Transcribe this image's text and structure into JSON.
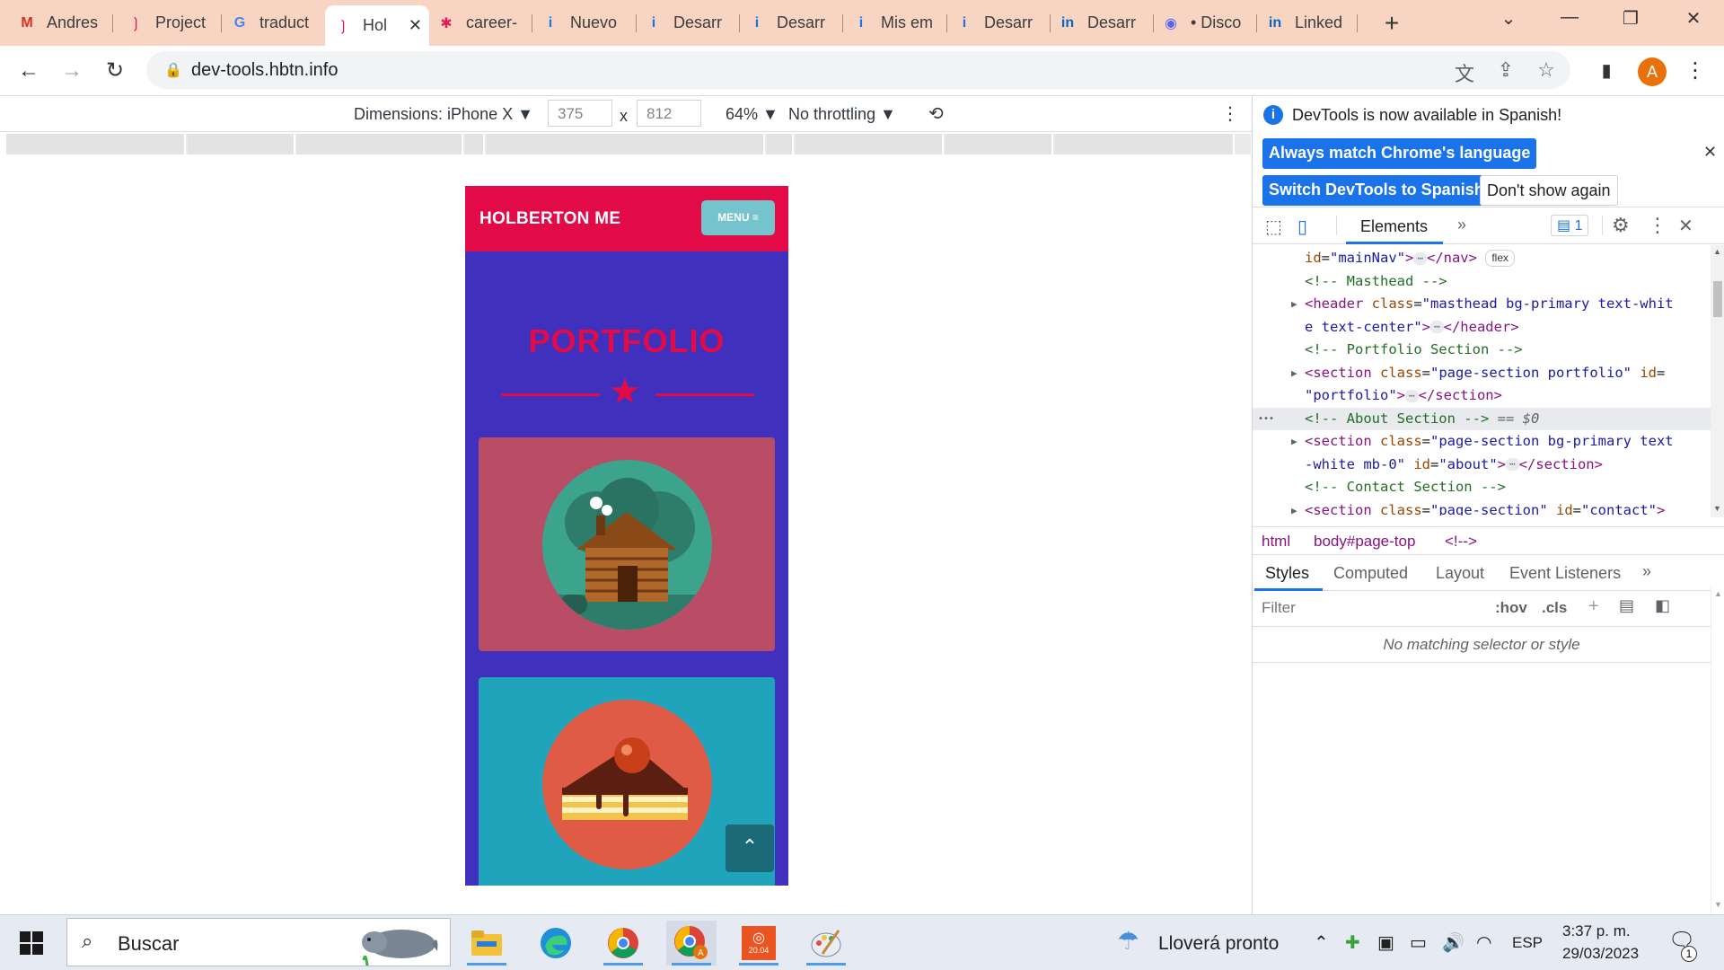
{
  "browser": {
    "tabs": [
      {
        "label": "Andres",
        "icon": "gmail-icon"
      },
      {
        "label": "Project",
        "icon": "holberton-icon"
      },
      {
        "label": "traduct",
        "icon": "google-icon"
      },
      {
        "label": "Hol",
        "icon": "holberton-icon",
        "active": true
      },
      {
        "label": "career-",
        "icon": "slack-icon"
      },
      {
        "label": "Nuevo",
        "icon": "info-icon"
      },
      {
        "label": "Desarr",
        "icon": "info-icon"
      },
      {
        "label": "Desarr",
        "icon": "info-icon"
      },
      {
        "label": "Mis em",
        "icon": "info-icon"
      },
      {
        "label": "Desarr",
        "icon": "info-icon"
      },
      {
        "label": "Desarr",
        "icon": "linkedin-icon"
      },
      {
        "label": "• Disco",
        "icon": "discord-icon"
      },
      {
        "label": "Linked",
        "icon": "linkedin-icon"
      }
    ],
    "url": "dev-tools.hbtn.info",
    "profile_initial": "A"
  },
  "device_toolbar": {
    "dimensions_label": "Dimensions: iPhone X ▼",
    "width": "375",
    "times": "x",
    "height": "812",
    "zoom": "64% ▼",
    "throttle": "No throttling ▼"
  },
  "page": {
    "brand": "HOLBERTON ME",
    "menu_label": "MENU ≡",
    "section_title": "PORTFOLIO",
    "colors": {
      "nav": "#e20a47",
      "bg": "#3f31bd",
      "card1": "#ba4d66",
      "card2": "#20a4bb"
    }
  },
  "devtools": {
    "info_text": "DevTools is now available in Spanish!",
    "btn_match": "Always match Chrome's language",
    "btn_switch": "Switch DevTools to Spanish",
    "btn_dont_show": "Don't show again",
    "panel_tab": "Elements",
    "issues_count": "1",
    "dom_lines": [
      {
        "parts": [
          [
            "an",
            "id"
          ],
          [
            "pl",
            "="
          ],
          [
            "av",
            "\"mainNav\""
          ],
          [
            "tg",
            ">"
          ]
        ],
        "ell": true,
        "after": [
          [
            "tg",
            "</nav>"
          ]
        ],
        "badge": "flex"
      },
      {
        "parts": [
          [
            "cm",
            "<!-- Masthead -->"
          ]
        ]
      },
      {
        "tri": true,
        "parts": [
          [
            "tg",
            "<header "
          ],
          [
            "an",
            "class"
          ],
          [
            "pl",
            "="
          ],
          [
            "av",
            "\"masthead bg-primary text-whit"
          ]
        ]
      },
      {
        "parts": [
          [
            "av",
            "e text-center\""
          ],
          [
            "tg",
            ">"
          ]
        ],
        "ell": true,
        "after": [
          [
            "tg",
            "</header>"
          ]
        ]
      },
      {
        "parts": [
          [
            "cm",
            "<!-- Portfolio Section -->"
          ]
        ]
      },
      {
        "tri": true,
        "parts": [
          [
            "tg",
            "<section "
          ],
          [
            "an",
            "class"
          ],
          [
            "pl",
            "="
          ],
          [
            "av",
            "\"page-section portfolio\" "
          ],
          [
            "an",
            "id"
          ],
          [
            "pl",
            "="
          ]
        ]
      },
      {
        "parts": [
          [
            "av",
            "\"portfolio\""
          ],
          [
            "tg",
            ">"
          ]
        ],
        "ell": true,
        "after": [
          [
            "tg",
            "</section>"
          ]
        ]
      },
      {
        "selected": true,
        "parts": [
          [
            "cm",
            "<!-- About Section -->"
          ],
          [
            "pl",
            " == "
          ],
          [
            "sel",
            "$0"
          ]
        ]
      },
      {
        "tri": true,
        "parts": [
          [
            "tg",
            "<section "
          ],
          [
            "an",
            "class"
          ],
          [
            "pl",
            "="
          ],
          [
            "av",
            "\"page-section bg-primary text"
          ]
        ]
      },
      {
        "parts": [
          [
            "av",
            "-white mb-0\" "
          ],
          [
            "an",
            "id"
          ],
          [
            "pl",
            "="
          ],
          [
            "av",
            "\"about\""
          ],
          [
            "tg",
            ">"
          ]
        ],
        "ell": true,
        "after": [
          [
            "tg",
            "</section>"
          ]
        ]
      },
      {
        "parts": [
          [
            "cm",
            "<!-- Contact Section -->"
          ]
        ]
      },
      {
        "tri": true,
        "parts": [
          [
            "tg",
            "<section "
          ],
          [
            "an",
            "class"
          ],
          [
            "pl",
            "="
          ],
          [
            "av",
            "\"page-section\" "
          ],
          [
            "an",
            "id"
          ],
          [
            "pl",
            "="
          ],
          [
            "av",
            "\"contact\""
          ],
          [
            "tg",
            ">"
          ]
        ]
      }
    ],
    "breadcrumbs": [
      "html",
      "body#page-top",
      "<!-->"
    ],
    "style_tabs": [
      "Styles",
      "Computed",
      "Layout",
      "Event Listeners"
    ],
    "filter_placeholder": "Filter",
    "hov": ":hov",
    "cls": ".cls",
    "empty_msg": "No matching selector or style"
  },
  "taskbar": {
    "search_placeholder": "Buscar",
    "weather": "Lloverá pronto",
    "lang": "ESP",
    "time": "3:37 p. m.",
    "date": "29/03/2023",
    "notif_count": "1",
    "ubuntu_label": "20.04"
  }
}
